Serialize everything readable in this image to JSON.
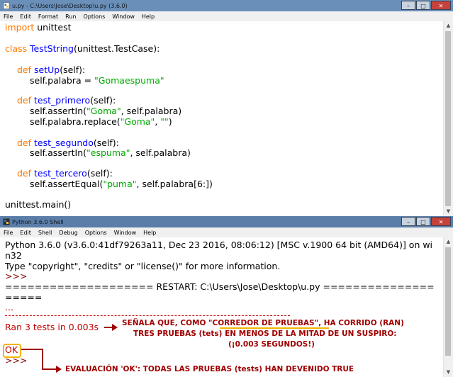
{
  "editor": {
    "title": "u.py - C:\\Users\\Jose\\Desktop\\u.py (3.6.0)",
    "menu": [
      "File",
      "Edit",
      "Format",
      "Run",
      "Options",
      "Window",
      "Help"
    ],
    "code": {
      "l1_kw": "import",
      "l1_rest": " unittest",
      "l3_kw": "class",
      "l3_name": "TestString",
      "l3_rest": "(unittest.TestCase):",
      "l5_kw": "def",
      "l5_name": "setUp",
      "l5_rest": "(self):",
      "l6_pre": "self.palabra = ",
      "l6_str": "\"Gomaespuma\"",
      "l8_kw": "def",
      "l8_name": "test_primero",
      "l8_rest": "(self):",
      "l9_pre": "self.assertIn(",
      "l9_str": "\"Goma\"",
      "l9_post": ", self.palabra)",
      "l10_pre": "self.palabra.replace(",
      "l10_s1": "\"Goma\"",
      "l10_mid": ", ",
      "l10_s2": "\"\"",
      "l10_post": ")",
      "l12_kw": "def",
      "l12_name": "test_segundo",
      "l12_rest": "(self):",
      "l13_pre": "self.assertIn(",
      "l13_str": "\"espuma\"",
      "l13_post": ", self.palabra)",
      "l15_kw": "def",
      "l15_name": "test_tercero",
      "l15_rest": "(self):",
      "l16_pre": "self.assertEqual(",
      "l16_str": "\"puma\"",
      "l16_post": ", self.palabra[6:])",
      "l18": "unittest.main()"
    }
  },
  "shell": {
    "title": "Python 3.6.0 Shell",
    "menu": [
      "File",
      "Edit",
      "Shell",
      "Debug",
      "Options",
      "Window",
      "Help"
    ],
    "banner1": "Python 3.6.0 (v3.6.0:41df79263a11, Dec 23 2016, 08:06:12) [MSC v.1900 64 bit (AMD64)] on wi",
    "banner2": "n32",
    "banner3": "Type \"copyright\", \"credits\" or \"license()\" for more information.",
    "prompt1": ">>> ",
    "restart1": "==================== RESTART: C:\\Users\\Jose\\Desktop\\u.py ===============",
    "restart2": "=====",
    "dots": "...",
    "ran": "Ran 3 tests in 0.003s",
    "ok": "OK",
    "prompt2": ">>> "
  },
  "annotations": {
    "a1_pre": "SEÑALA QUE, COMO \"",
    "a1_hl": "CORREDOR DE PRUEBAS",
    "a1_post": "\", HA CORRIDO (RAN)",
    "a2": "TRES PRUEBAS (tets) EN MENOS DE LA MITAD DE UN SUSPIRO:",
    "a3": "(¡0.003 SEGUNDOS!)",
    "a4": "EVALUACIÓN 'OK': TODAS LAS PRUEBAS (tests) HAN DEVENIDO TRUE"
  },
  "window_buttons": {
    "minimize": "–",
    "maximize": "□",
    "close": "✕"
  },
  "colors": {
    "keyword": "#ff7700",
    "defname": "#0000ff",
    "string": "#00aa00",
    "error": "#c00000",
    "annotation": "#a00000",
    "highlight": "#f4b400"
  }
}
